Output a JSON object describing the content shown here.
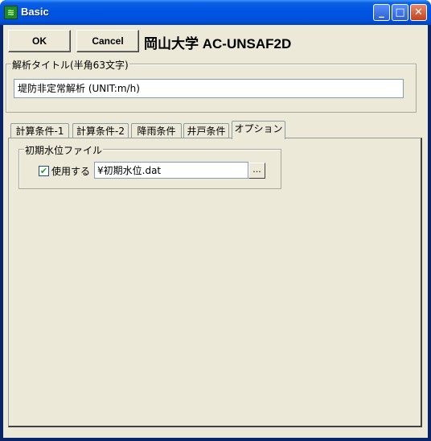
{
  "window": {
    "title": "Basic",
    "app_icon": "app-icon",
    "controls": {
      "minimize": "_",
      "maximize": "□",
      "close": "✕"
    }
  },
  "toolbar": {
    "ok_label": "OK",
    "cancel_label": "Cancel",
    "heading": "岡山大学 AC-UNSAF2D"
  },
  "analysis_title": {
    "group_label": "解析タイトル(半角63文字)",
    "value": "堤防非定常解析 (UNIT:m/h)"
  },
  "tabs": [
    {
      "label": "計算条件-1",
      "active": false
    },
    {
      "label": "計算条件-2",
      "active": false
    },
    {
      "label": "降雨条件",
      "active": false
    },
    {
      "label": "井戸条件",
      "active": false
    },
    {
      "label": "オプション",
      "active": true
    }
  ],
  "options_tab": {
    "group_label": "初期水位ファイル",
    "use_checkbox": {
      "label": "使用する",
      "checked": true,
      "mark": "✔"
    },
    "file_value": "¥初期水位.dat",
    "browse_label": "..."
  }
}
